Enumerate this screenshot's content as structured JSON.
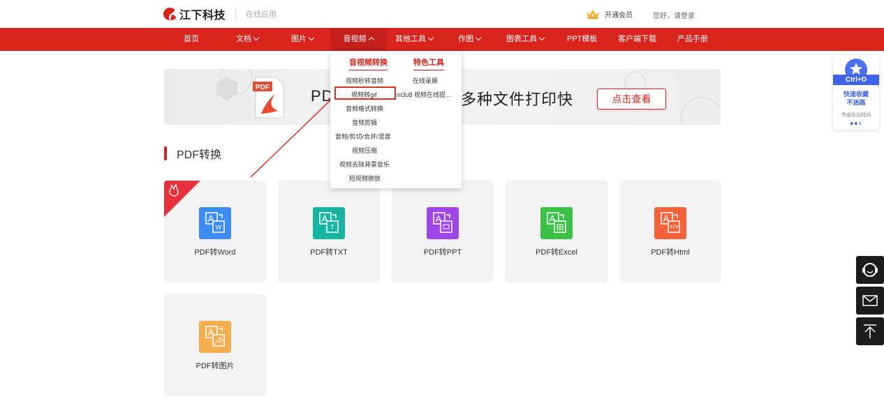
{
  "brand": {
    "name": "江下科技",
    "subtitle": "在线应用",
    "logo_color": "#d9231d"
  },
  "header": {
    "vip_label": "开通会员",
    "login_label": "您好，请登录"
  },
  "nav": {
    "items": [
      {
        "label": "首页",
        "dropdown": false
      },
      {
        "label": "文档",
        "dropdown": true
      },
      {
        "label": "图片",
        "dropdown": true
      },
      {
        "label": "音视频",
        "dropdown": true,
        "active": true
      },
      {
        "label": "其他工具",
        "dropdown": true
      },
      {
        "label": "作图",
        "dropdown": true
      },
      {
        "label": "图表工具",
        "dropdown": true
      },
      {
        "label": "PPT模板",
        "dropdown": false
      },
      {
        "label": "客户端下载",
        "dropdown": false
      },
      {
        "label": "产品手册",
        "dropdown": false
      }
    ],
    "bg_color": "#d9231d"
  },
  "dropdown": {
    "col1_title": "音视频转换",
    "col2_title": "特色工具",
    "col1_items": [
      "视频秒转音频",
      "视频转gif",
      "音频格式转换",
      "音频剪辑",
      "音频/剪切/合并/混音",
      "视频压缩",
      "视频去除背景音乐",
      "短视频倒放"
    ],
    "col2_items": [
      "在线录屏",
      "m3u8 视频在线提..."
    ]
  },
  "banner": {
    "text_left": "PD",
    "text_right": "多种文件打印快",
    "button_label": "点击查看",
    "doc_label": "PDF"
  },
  "section": {
    "title": "PDF转换"
  },
  "cards": [
    {
      "label": "PDF转Word",
      "color": "#3d8bf5",
      "glyph": "W",
      "hot": true
    },
    {
      "label": "PDF转TXT",
      "color": "#16b3a0",
      "glyph": "T",
      "hot": false
    },
    {
      "label": "PDF转PPT",
      "color": "#a045e8",
      "glyph": "P",
      "hot": false
    },
    {
      "label": "PDF转Excel",
      "color": "#3cbf46",
      "glyph": "E",
      "hot": false
    },
    {
      "label": "PDF转Html",
      "color": "#f5633c",
      "glyph": "H",
      "hot": false
    },
    {
      "label": "PDF转图片",
      "color": "#f5ae4f",
      "glyph": "I",
      "hot": false
    }
  ],
  "side": {
    "shortcut": "Ctrl+D",
    "line1": "快速收藏",
    "line2": "不迷路",
    "line3": "节省办公时间",
    "close": "×",
    "accent": "#3f63e6"
  },
  "float_buttons": [
    "customer-service-icon",
    "mail-icon",
    "back-to-top-icon"
  ]
}
